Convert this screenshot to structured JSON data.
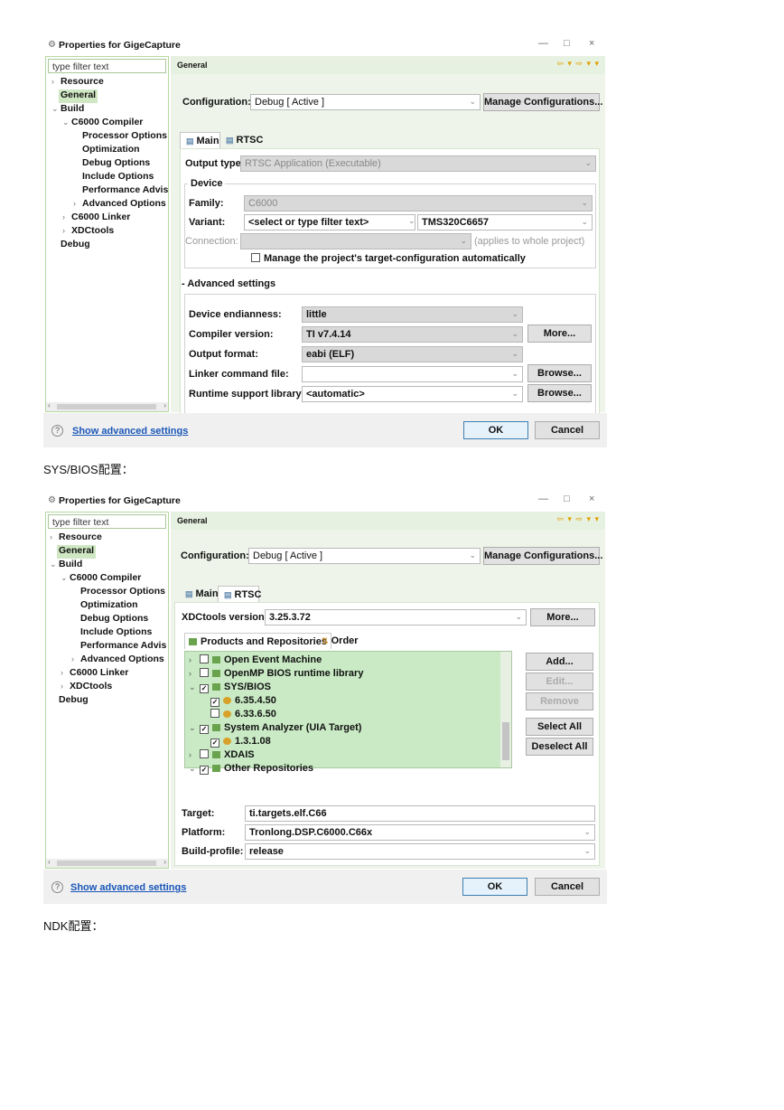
{
  "shot1": {
    "window_title": "Properties for GigeCapture",
    "window_buttons": [
      "—",
      "□",
      "×"
    ],
    "filter_placeholder": "type filter text",
    "tree": [
      "Resource",
      "General",
      "Build",
      "C6000 Compiler",
      "Processor Options",
      "Optimization",
      "Debug Options",
      "Include Options",
      "Performance Advis",
      "Advanced Options",
      "C6000 Linker",
      "XDCtools",
      "Debug"
    ],
    "panel_title": "General",
    "configuration_label": "Configuration:",
    "configuration_value": "Debug  [ Active ]",
    "manage_button": "Manage Configurations...",
    "tabs": [
      "Main",
      "RTSC"
    ],
    "output_type_label": "Output type:",
    "output_type_value": "RTSC Application (Executable)",
    "device_group": "Device",
    "family_label": "Family:",
    "family_value": "C6000",
    "variant_label": "Variant:",
    "variant_filter": "<select or type filter text>",
    "variant_value": "TMS320C6657",
    "connection_label": "Connection:",
    "connection_note": "(applies to whole project)",
    "manage_target_checkbox": "Manage the project's target-configuration automatically",
    "advanced_settings_title": "Advanced settings",
    "advanced": [
      {
        "label": "Device endianness:",
        "value": "little",
        "button": ""
      },
      {
        "label": "Compiler version:",
        "value": "TI v7.4.14",
        "button": "More..."
      },
      {
        "label": "Output format:",
        "value": "eabi (ELF)",
        "button": ""
      },
      {
        "label": "Linker command file:",
        "value": "",
        "button": "Browse..."
      },
      {
        "label": "Runtime support library:",
        "value": "<automatic>",
        "button": "Browse..."
      }
    ],
    "show_advanced": "Show advanced settings",
    "ok": "OK",
    "cancel": "Cancel"
  },
  "caption1": "SYS/BIOS配置：",
  "shot2": {
    "window_title": "Properties for GigeCapture",
    "window_buttons": [
      "—",
      "□",
      "×"
    ],
    "filter_placeholder": "type filter text",
    "tree": [
      "Resource",
      "General",
      "Build",
      "C6000 Compiler",
      "Processor Options",
      "Optimization",
      "Debug Options",
      "Include Options",
      "Performance Advis",
      "Advanced Options",
      "C6000 Linker",
      "XDCtools",
      "Debug"
    ],
    "panel_title": "General",
    "configuration_label": "Configuration:",
    "configuration_value": "Debug  [ Active ]",
    "manage_button": "Manage Configurations...",
    "tabs": [
      "Main",
      "RTSC"
    ],
    "xdc_label": "XDCtools version:",
    "xdc_value": "3.25.3.72",
    "more_button": "More...",
    "sub_tabs": [
      "Products and Repositories",
      "Order"
    ],
    "repos": [
      "Open Event Machine",
      "OpenMP BIOS runtime library",
      "SYS/BIOS",
      "6.35.4.50",
      "6.33.6.50",
      "System Analyzer (UIA Target)",
      "1.3.1.08",
      "XDAIS",
      "Other Repositories"
    ],
    "repo_buttons": [
      "Add...",
      "Edit...",
      "Remove",
      "Select All",
      "Deselect All"
    ],
    "target_label": "Target:",
    "target_value": "ti.targets.elf.C66",
    "platform_label": "Platform:",
    "platform_value": "Tronlong.DSP.C6000.C66x",
    "profile_label": "Build-profile:",
    "profile_value": "release",
    "show_advanced": "Show advanced settings",
    "ok": "OK",
    "cancel": "Cancel"
  },
  "caption2": "NDK配置："
}
